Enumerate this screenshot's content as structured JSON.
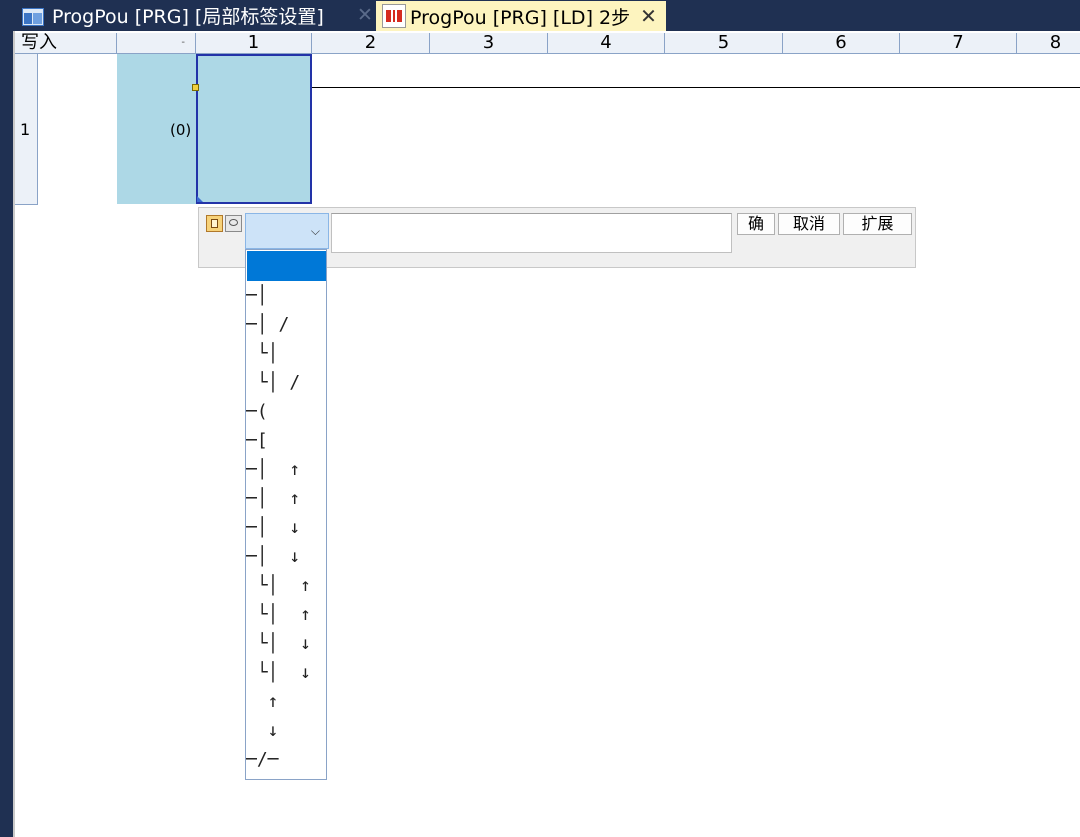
{
  "tabs": [
    {
      "label": "ProgPou [PRG] [局部标签设置]",
      "active": false
    },
    {
      "label": "ProgPou [PRG] [LD] 2步",
      "active": true
    }
  ],
  "tab_close_glyph": "✕",
  "grid": {
    "first_header": "写入",
    "dd_glyph": "-",
    "columns": [
      "1",
      "2",
      "3",
      "4",
      "5",
      "6",
      "7",
      "8"
    ],
    "row_label": "1",
    "step_number": "(0)"
  },
  "editbar": {
    "combo_value": "",
    "combo_arrow": "⌵",
    "text_value": "",
    "ok_label": "确",
    "cancel_label": "取消",
    "expand_label": "扩展"
  },
  "dropdown_items": [
    "",
    "─│",
    "─│ /",
    " └│",
    " └│ /",
    "─(",
    "─[",
    "─│  ↑",
    "─│  ↑",
    "─│  ↓",
    "─│  ↓",
    " └│  ↑",
    " └│  ↑",
    " └│  ↓",
    " └│  ↓",
    "  ↑",
    "  ↓",
    "─/─"
  ],
  "colors": {
    "tabbar": "#1f3052",
    "active_tab": "#fdf4bf",
    "header_bg": "#ecf1f8",
    "rung_highlight": "#add8e6",
    "cursor_border": "#2233a8",
    "dropdown_selection": "#0078d7"
  }
}
